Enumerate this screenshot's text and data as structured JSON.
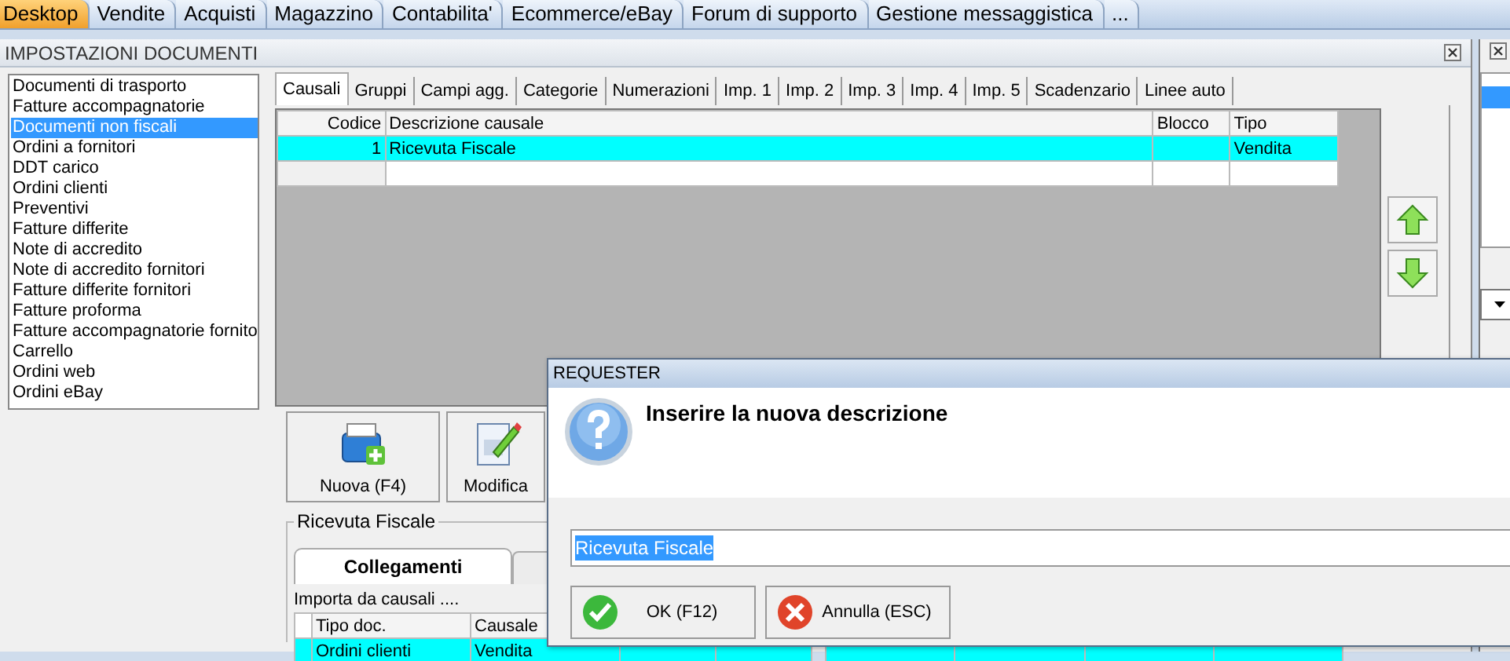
{
  "top_tabs": [
    {
      "label": "Desktop",
      "selected": true
    },
    {
      "label": "Vendite",
      "selected": false
    },
    {
      "label": "Acquisti",
      "selected": false
    },
    {
      "label": "Magazzino",
      "selected": false
    },
    {
      "label": "Contabilita'",
      "selected": false
    },
    {
      "label": "Ecommerce/eBay",
      "selected": false
    },
    {
      "label": "Forum di supporto",
      "selected": false
    },
    {
      "label": "Gestione messaggistica",
      "selected": false
    },
    {
      "label": "...",
      "selected": false
    }
  ],
  "window": {
    "title": "IMPOSTAZIONI DOCUMENTI"
  },
  "document_types": [
    {
      "label": "Documenti di trasporto",
      "selected": false
    },
    {
      "label": "Fatture accompagnatorie",
      "selected": false
    },
    {
      "label": "Documenti non fiscali",
      "selected": true
    },
    {
      "label": "Ordini a fornitori",
      "selected": false
    },
    {
      "label": "DDT carico",
      "selected": false
    },
    {
      "label": "Ordini clienti",
      "selected": false
    },
    {
      "label": "Preventivi",
      "selected": false
    },
    {
      "label": "Fatture differite",
      "selected": false
    },
    {
      "label": "Note di accredito",
      "selected": false
    },
    {
      "label": "Note di accredito fornitori",
      "selected": false
    },
    {
      "label": "Fatture differite fornitori",
      "selected": false
    },
    {
      "label": "Fatture proforma",
      "selected": false
    },
    {
      "label": "Fatture accompagnatorie fornito",
      "selected": false
    },
    {
      "label": "Carrello",
      "selected": false
    },
    {
      "label": "Ordini web",
      "selected": false
    },
    {
      "label": "Ordini eBay",
      "selected": false
    }
  ],
  "settings_tabs": [
    {
      "label": "Causali",
      "selected": true
    },
    {
      "label": "Gruppi",
      "selected": false
    },
    {
      "label": "Campi agg.",
      "selected": false
    },
    {
      "label": "Categorie",
      "selected": false
    },
    {
      "label": "Numerazioni",
      "selected": false
    },
    {
      "label": "Imp. 1",
      "selected": false
    },
    {
      "label": "Imp. 2",
      "selected": false
    },
    {
      "label": "Imp. 3",
      "selected": false
    },
    {
      "label": "Imp. 4",
      "selected": false
    },
    {
      "label": "Imp. 5",
      "selected": false
    },
    {
      "label": "Scadenzario",
      "selected": false
    },
    {
      "label": "Linee auto",
      "selected": false
    }
  ],
  "causali_table": {
    "columns": [
      "Codice",
      "Descrizione causale",
      "Blocco",
      "Tipo"
    ],
    "rows": [
      {
        "codice": "1",
        "descrizione_causale": "Ricevuta Fiscale",
        "tipo": "Vendita",
        "selected": true
      }
    ]
  },
  "actions": [
    {
      "label": "Nuova (F4)",
      "kind": "new"
    },
    {
      "label": "Modifica",
      "kind": "edit"
    }
  ],
  "detail": {
    "title": "Ricevuta Fiscale",
    "tabs": [
      {
        "label": "Collegamenti",
        "selected": true
      }
    ],
    "import_label": "Importa da causali ....",
    "import_table": {
      "columns": [
        "Tipo doc.",
        "Causale"
      ],
      "rows": [
        {
          "tipo_doc": "Ordini clienti",
          "causale": "Vendita",
          "selected": true
        }
      ]
    }
  },
  "dialog": {
    "title": "REQUESTER",
    "message": "Inserire la nuova descrizione",
    "input": {
      "value": "Ricevuta Fiscale"
    },
    "buttons": [
      {
        "label": "OK (F12)",
        "kind": "ok"
      },
      {
        "label": "Annulla (ESC)",
        "kind": "cancel"
      }
    ]
  }
}
